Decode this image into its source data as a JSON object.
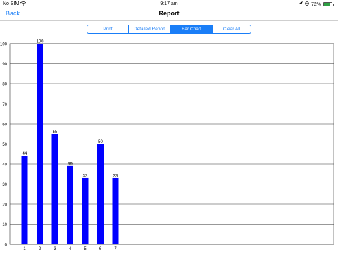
{
  "status": {
    "carrier": "No SIM",
    "wifi_icon": "wifi-icon",
    "time": "9:17 am",
    "battery_percent_text": "72%",
    "battery_level": 0.72,
    "icons": [
      "location-icon",
      "orientation-lock-icon"
    ]
  },
  "nav": {
    "back_label": "Back",
    "title": "Report"
  },
  "segments": {
    "print": "Print",
    "detailed": "Detailed Report",
    "bar": "Bar Chart",
    "clear": "Clear All",
    "active": "bar"
  },
  "colors": {
    "accent": "#1a7ef7",
    "bar": "#0000ff",
    "battery": "#2ea043"
  },
  "chart_data": {
    "type": "bar",
    "categories": [
      "1",
      "2",
      "3",
      "4",
      "5",
      "6",
      "7"
    ],
    "values": [
      44,
      100,
      55,
      39,
      33,
      50,
      33
    ],
    "ylim": [
      0,
      100
    ],
    "yticks": [
      0,
      10,
      20,
      30,
      40,
      50,
      60,
      70,
      80,
      90,
      100
    ],
    "grid": true,
    "data_labels": true,
    "title": "",
    "xlabel": "",
    "ylabel": ""
  }
}
